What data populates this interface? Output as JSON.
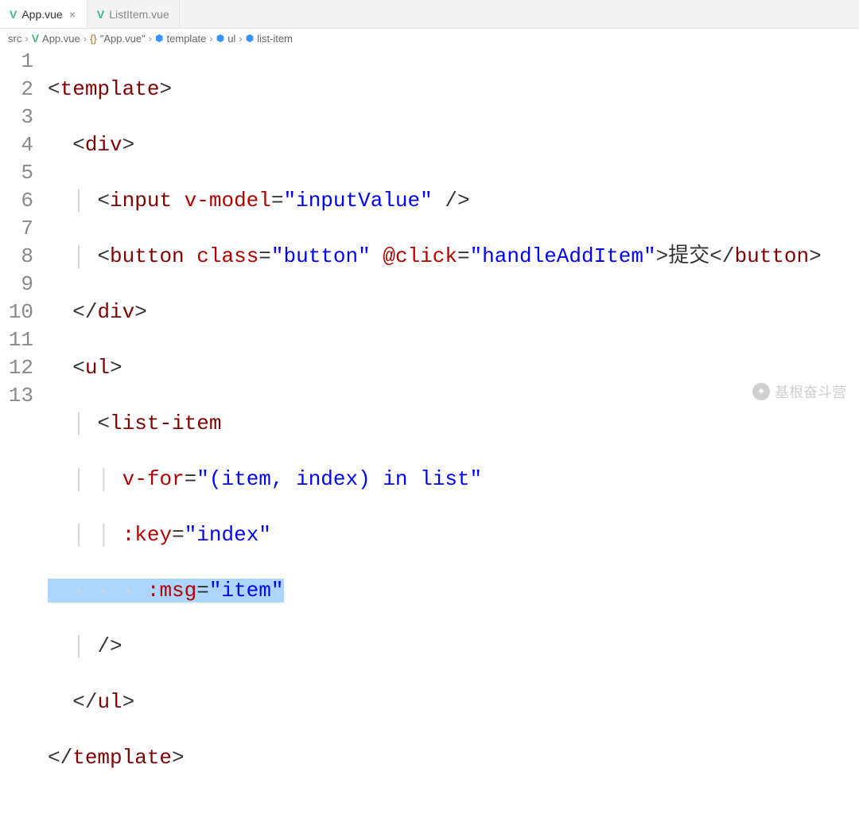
{
  "tabs": [
    {
      "label": "App.vue",
      "active": true,
      "closable": true
    },
    {
      "label": "ListItem.vue",
      "active": false,
      "closable": false
    }
  ],
  "breadcrumbs": {
    "items": [
      "src",
      "App.vue",
      "\"App.vue\"",
      "template",
      "ul",
      "list-item"
    ]
  },
  "gutter": [
    "1",
    "2",
    "3",
    "4",
    "5",
    "6",
    "7",
    "8",
    "9",
    "10",
    "11",
    "12",
    "13"
  ],
  "code": {
    "l1": {
      "tag": "template"
    },
    "l2": {
      "tag": "div"
    },
    "l3": {
      "tag": "input",
      "attr": "v-model",
      "val": "\"inputValue\""
    },
    "l4": {
      "tag": "button",
      "attr1": "class",
      "val1": "\"button\"",
      "attr2": "@click",
      "val2": "\"handleAddItem\"",
      "text": "提交"
    },
    "l5": {
      "tag": "div"
    },
    "l6": {
      "tag": "ul"
    },
    "l7": {
      "tag": "list-item"
    },
    "l8": {
      "attr": "v-for",
      "val": "\"(item, index) in list\""
    },
    "l9": {
      "attr": ":key",
      "val": "\"index\""
    },
    "l10": {
      "attr": ":msg",
      "val": "\"item\""
    },
    "l11": {
      "close": "/>"
    },
    "l12": {
      "tag": "ul"
    },
    "l13": {
      "tag": "template"
    }
  },
  "watermark": {
    "text": "基根奋斗营"
  }
}
